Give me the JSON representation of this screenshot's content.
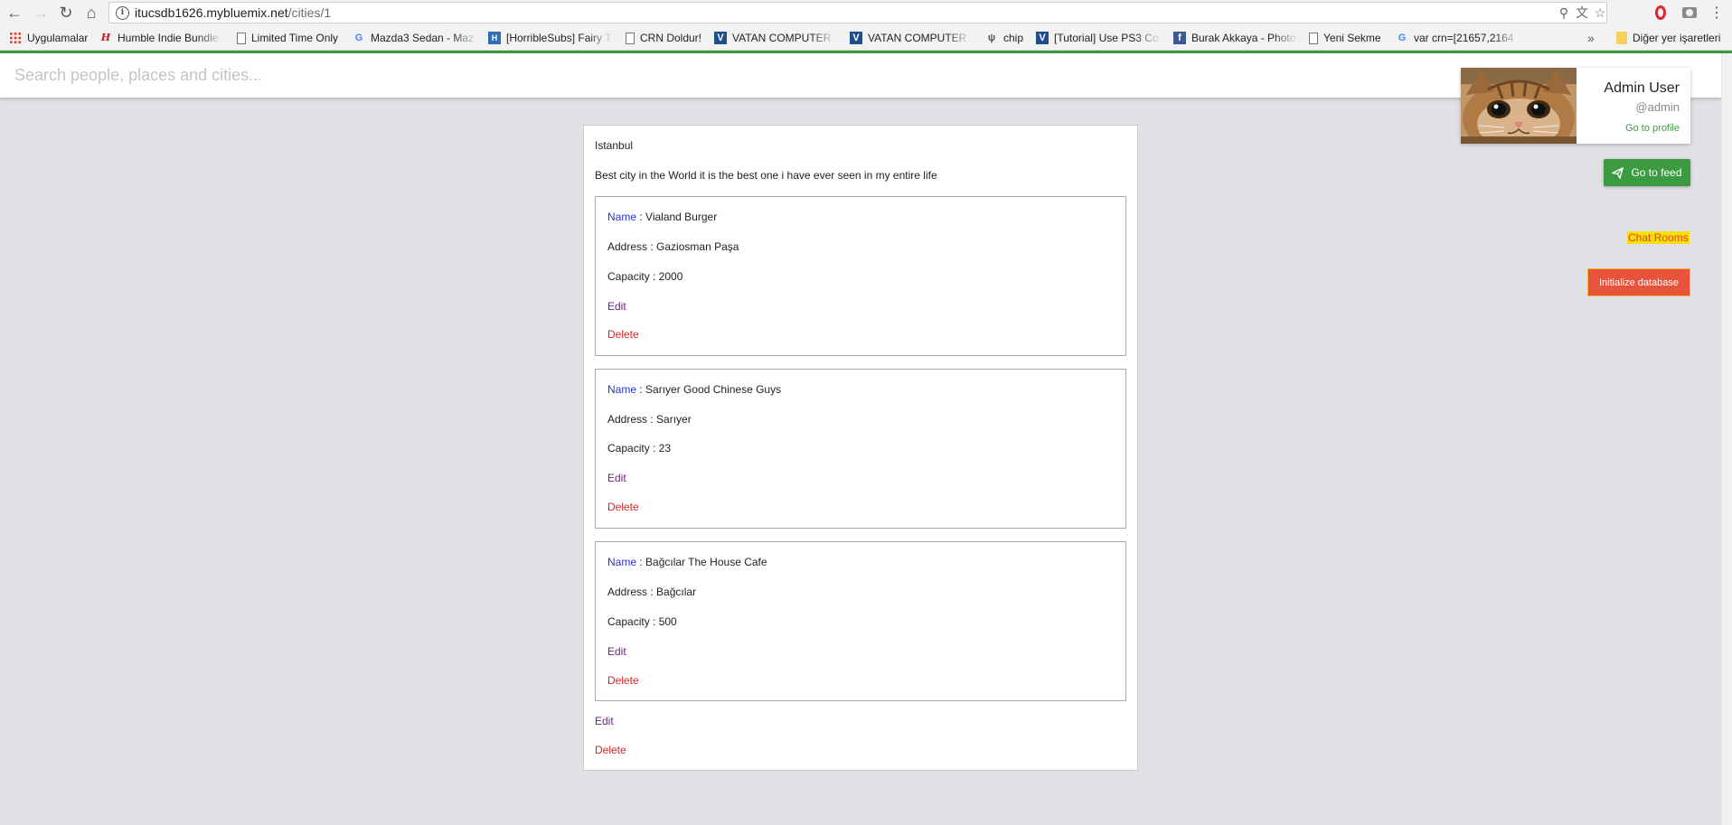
{
  "browser": {
    "url_host": "itucsdb1626.mybluemix.net",
    "url_path": "/cities/1",
    "bookmarks": [
      {
        "label": "Uygulamalar",
        "icon": "apps-grid-icon"
      },
      {
        "label": "Humble Indie Bundle:",
        "icon": "humble-h-icon"
      },
      {
        "label": "Limited Time Only",
        "icon": "page-icon"
      },
      {
        "label": "Mazda3 Sedan - Maz",
        "icon": "google-g-icon"
      },
      {
        "label": "[HorribleSubs] Fairy T",
        "icon": "horriblesubs-icon"
      },
      {
        "label": "CRN Doldur!",
        "icon": "page-icon"
      },
      {
        "label": "VATAN COMPUTER -",
        "icon": "vatan-v-icon"
      },
      {
        "label": "VATAN COMPUTER -",
        "icon": "vatan-v-icon"
      },
      {
        "label": "chip",
        "icon": "chip-icon"
      },
      {
        "label": "[Tutorial] Use PS3 Co",
        "icon": "tutorial-icon"
      },
      {
        "label": "Burak Akkaya - Photo",
        "icon": "facebook-icon"
      },
      {
        "label": "Yeni Sekme",
        "icon": "page-icon"
      },
      {
        "label": "var crn=[21657,2164",
        "icon": "google-g-icon"
      }
    ],
    "overflow_chevron": "»",
    "other_bookmarks": "Diğer yer işaretleri"
  },
  "header": {
    "search_placeholder": "Search people, places and cities..."
  },
  "profile": {
    "name": "Admin User",
    "handle": "@admin",
    "link": "Go to profile"
  },
  "sidebar": {
    "feed_button": "Go to feed",
    "chat_link": "Chat Rooms",
    "init_button": "Initialize database"
  },
  "city": {
    "name": "Istanbul",
    "description": "Best city in the World it is the best one i have ever seen in my entire life",
    "edit": "Edit",
    "delete": "Delete",
    "places": [
      {
        "name_label": "Name",
        "name": "Vialand Burger",
        "address_label": "Address",
        "address": "Gaziosman Paşa",
        "capacity_label": "Capacity",
        "capacity": "2000",
        "edit": "Edit",
        "delete": "Delete"
      },
      {
        "name_label": "Name",
        "name": "Sarıyer Good Chinese Guys",
        "address_label": "Address",
        "address": "Sarıyer",
        "capacity_label": "Capacity",
        "capacity": "23",
        "edit": "Edit",
        "delete": "Delete"
      },
      {
        "name_label": "Name",
        "name": "Bağcılar The House Cafe",
        "address_label": "Address",
        "address": "Bağcılar",
        "capacity_label": "Capacity",
        "capacity": "500",
        "edit": "Edit",
        "delete": "Delete"
      }
    ]
  },
  "colors": {
    "accent_green": "#3c9a40",
    "init_button": "#e8533b",
    "delete_red": "#e01f1f",
    "edit_purple": "#6b2083",
    "label_blue": "#2a31d8"
  }
}
